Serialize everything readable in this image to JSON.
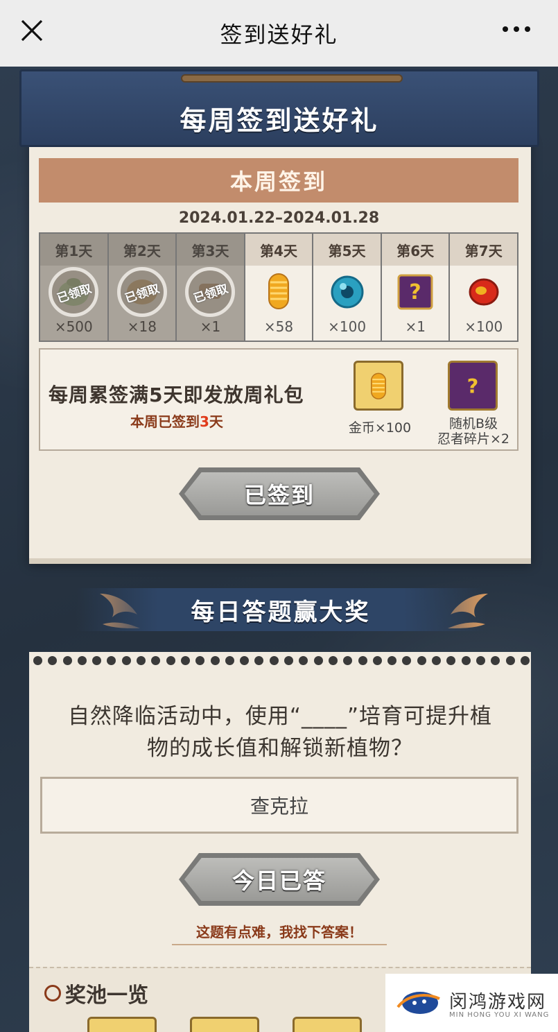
{
  "nav": {
    "title": "签到送好礼"
  },
  "signin": {
    "header": "每周签到送好礼",
    "week_banner": "本周签到",
    "date_range": "2024.01.22–2024.01.28",
    "days": [
      {
        "label": "第1天",
        "count": "×500",
        "claimed": true,
        "stamp": "已领取",
        "icon": "green-pouch-icon"
      },
      {
        "label": "第2天",
        "count": "×18",
        "claimed": true,
        "stamp": "已领取",
        "icon": "bean-bag-icon"
      },
      {
        "label": "第3天",
        "count": "×1",
        "claimed": true,
        "stamp": "已领取",
        "icon": "scroll-icon"
      },
      {
        "label": "第4天",
        "count": "×58",
        "claimed": false,
        "icon": "gold-coin-icon"
      },
      {
        "label": "第5天",
        "count": "×100",
        "claimed": false,
        "icon": "chakra-orb-icon"
      },
      {
        "label": "第6天",
        "count": "×1",
        "claimed": false,
        "icon": "ninja-fragment-icon"
      },
      {
        "label": "第7天",
        "count": "×100",
        "claimed": false,
        "icon": "red-ruby-icon"
      }
    ],
    "bonus": {
      "title": "每周累签满5天即发放周礼包",
      "progress_prefix": "本周已签到",
      "progress_count": "3",
      "progress_suffix": "天",
      "rewards": [
        {
          "label": "金币×100",
          "icon": "gold-coin-icon"
        },
        {
          "label_line1": "随机B级",
          "label_line2": "忍者碎片×2",
          "icon": "ninja-fragment-icon"
        }
      ]
    },
    "button": "已签到"
  },
  "quiz": {
    "header": "每日答题赢大奖",
    "question_line1": "自然降临活动中，使用“____”培育可提升植",
    "question_line2": "物的成长值和解锁新植物？",
    "answer": "查克拉",
    "button": "今日已答",
    "hint": "这题有点难，我找下答案！"
  },
  "prize_pool": {
    "title": "奖池一览"
  },
  "watermark": {
    "name": "闵鸿游戏网",
    "pinyin": "MIN HONG YOU XI WANG"
  },
  "colors": {
    "nav_bg": "#ededed",
    "header_blue": "#2e4566",
    "panel_paper": "#f1ebe0",
    "banner_tan": "#c28c6c",
    "accent_red": "#e03a1a"
  }
}
